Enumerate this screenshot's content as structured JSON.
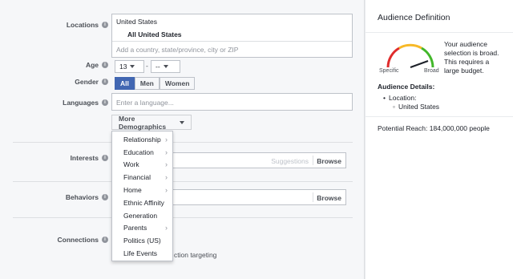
{
  "locations": {
    "label": "Locations",
    "country": "United States",
    "option": "All United States",
    "placeholder": "Add a country, state/province, city or ZIP"
  },
  "age": {
    "label": "Age",
    "min": "13",
    "sep": "-",
    "max": "--"
  },
  "gender": {
    "label": "Gender",
    "options": [
      "All",
      "Men",
      "Women"
    ],
    "selected": "All"
  },
  "languages": {
    "label": "Languages",
    "placeholder": "Enter a language..."
  },
  "more_demographics": {
    "label": "More Demographics",
    "items": [
      {
        "label": "Relationship",
        "submenu": true
      },
      {
        "label": "Education",
        "submenu": true
      },
      {
        "label": "Work",
        "submenu": true
      },
      {
        "label": "Financial",
        "submenu": true
      },
      {
        "label": "Home",
        "submenu": true
      },
      {
        "label": "Ethnic Affinity",
        "submenu": false
      },
      {
        "label": "Generation",
        "submenu": false
      },
      {
        "label": "Parents",
        "submenu": true
      },
      {
        "label": "Politics (US)",
        "submenu": false
      },
      {
        "label": "Life Events",
        "submenu": false
      }
    ]
  },
  "interests": {
    "label": "Interests",
    "suggestions": "Suggestions",
    "browse": "Browse"
  },
  "behaviors": {
    "label": "Behaviors",
    "browse": "Browse"
  },
  "connections": {
    "label": "Connections",
    "partial_text": "ction targeting"
  },
  "audience": {
    "title": "Audience Definition",
    "gauge_low": "Specific",
    "gauge_high": "Broad",
    "description": "Your audience selection is broad. This requires a large budget.",
    "details_title": "Audience Details:",
    "location_label": "Location:",
    "location_value": "United States",
    "reach": "Potential Reach: 184,000,000 people",
    "colors": {
      "low": "#e02c2c",
      "mid": "#f7b928",
      "high": "#42b72a"
    }
  }
}
